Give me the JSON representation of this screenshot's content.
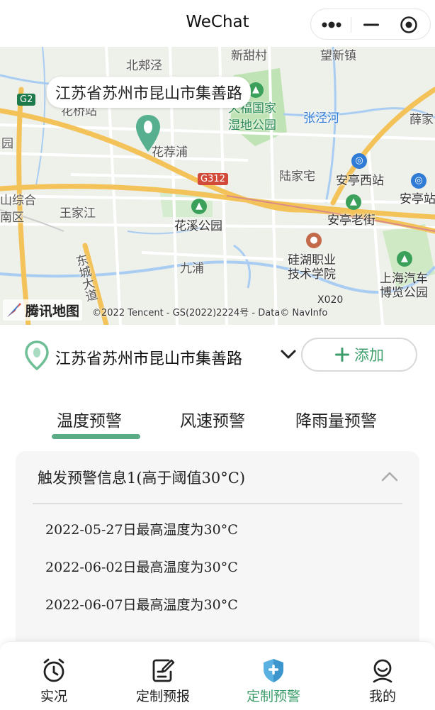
{
  "window": {
    "title": "WeChat"
  },
  "map": {
    "bubble_address": "江苏省苏州市昆山市集善路",
    "labels": {
      "xinzhaocun": "新甜村",
      "wangxinzhen": "望新镇",
      "beijiajing": "北郏泾",
      "tianfu": "天福国家",
      "shidi": "湿地公园",
      "zhangjinghe": "张泾河",
      "xue": "薛家",
      "huaqiao": "花桥站",
      "huajianpu": "花荐浦",
      "lujiazhai": "陆家宅",
      "anting_west": "安亭西站",
      "anting_station": "安亭站",
      "shan_zonghe": "山综合",
      "nanqu": "南区",
      "wangjiajiang": "王家江",
      "huaxi_park": "花溪公园",
      "anting_old": "安亭老街",
      "jiupu": "九浦",
      "guihu": "硅湖职业",
      "jishu": "技术学院",
      "shanghai_auto": "上海汽车",
      "expo_park": "博览公园",
      "dongcheng": "东城大道",
      "zhou": "园"
    },
    "road_g2": "G2",
    "road_g312": "G312",
    "road_x020": "X020",
    "logo_text": "腾讯地图",
    "copyright": "©2022 Tencent - GS(2022)2224号 - Data© NavInfo"
  },
  "location": {
    "address": "江苏省苏州市昆山市集善路",
    "add_label": "添加"
  },
  "tabs": [
    {
      "label": "温度预警",
      "active": true
    },
    {
      "label": "风速预警",
      "active": false
    },
    {
      "label": "降雨量预警",
      "active": false
    }
  ],
  "card": {
    "header": "触发预警信息1(高于阈值30°C)",
    "rows": [
      "2022-05-27日最高温度为30°C",
      "2022-06-02日最高温度为30°C",
      "2022-06-07日最高温度为30°C"
    ]
  },
  "nav": [
    {
      "label": "实况",
      "icon": "alarm-clock-icon",
      "active": false
    },
    {
      "label": "定制预报",
      "icon": "edit-note-icon",
      "active": false
    },
    {
      "label": "定制预警",
      "icon": "shield-plus-icon",
      "active": true
    },
    {
      "label": "我的",
      "icon": "user-face-icon",
      "active": false
    }
  ],
  "colors": {
    "accent": "#3e9e6b",
    "tab_underline": "#5aab86",
    "map_road_major": "#f3c35a",
    "map_water": "#a9cdf2",
    "map_green": "#bfe3b4"
  }
}
